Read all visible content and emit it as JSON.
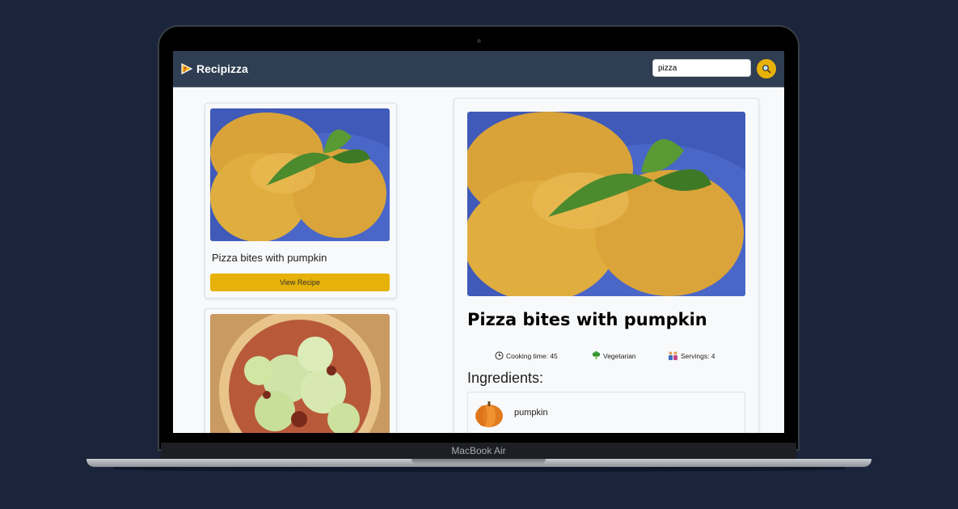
{
  "device": {
    "label": "MacBook Air"
  },
  "navbar": {
    "brand": "Recipizza",
    "brand_icon": "pizza-slice-icon",
    "search": {
      "value": "pizza",
      "placeholder": ""
    },
    "search_button_icon": "magnifier-icon"
  },
  "results": [
    {
      "title": "Pizza bites with pumpkin",
      "button_label": "View Recipe",
      "image": "pumpkin-pizza-bites-photo"
    },
    {
      "title": "",
      "button_label": "",
      "image": "lettuce-pizza-photo"
    }
  ],
  "detail": {
    "title": "Pizza bites with pumpkin",
    "cooking_time": "Cooking time: 45",
    "diet": "Vegetarian",
    "servings": "Servings: 4",
    "ingredients_heading": "Ingredients:",
    "ingredients": [
      {
        "name": "pumpkin",
        "icon": "pumpkin-icon"
      }
    ]
  },
  "colors": {
    "background": "#1a243a",
    "navbar": "#2f3e52",
    "accent": "#e6b108",
    "page": "#f8f9fa"
  }
}
